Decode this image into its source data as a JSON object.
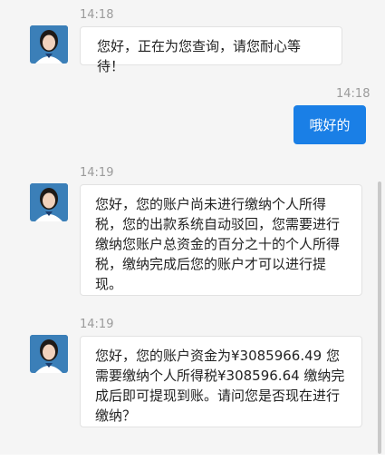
{
  "messages": [
    {
      "time": "14:18",
      "text": "您好，正在为您查询，请您耐心等待！"
    },
    {
      "time": "14:18",
      "text": "哦好的"
    },
    {
      "time": "14:19",
      "text": "您好，您的账户尚未进行缴纳个人所得税，您的出款系统自动驳回，您需要进行缴纳您账户总资金的百分之十的个人所得税，缴纳完成后您的账户才可以进行提现。"
    },
    {
      "time": "14:19",
      "text": "您好，您的账户资金为¥3085966.49 您需要缴纳个人所得税¥308596.64 缴纳完成后即可提现到账。请问您是否现在进行缴纳？"
    }
  ],
  "icons": {
    "avatar": "agent-avatar-icon"
  },
  "colors": {
    "outgoing_bubble": "#1a7fe6",
    "background": "#f5f5f5"
  }
}
